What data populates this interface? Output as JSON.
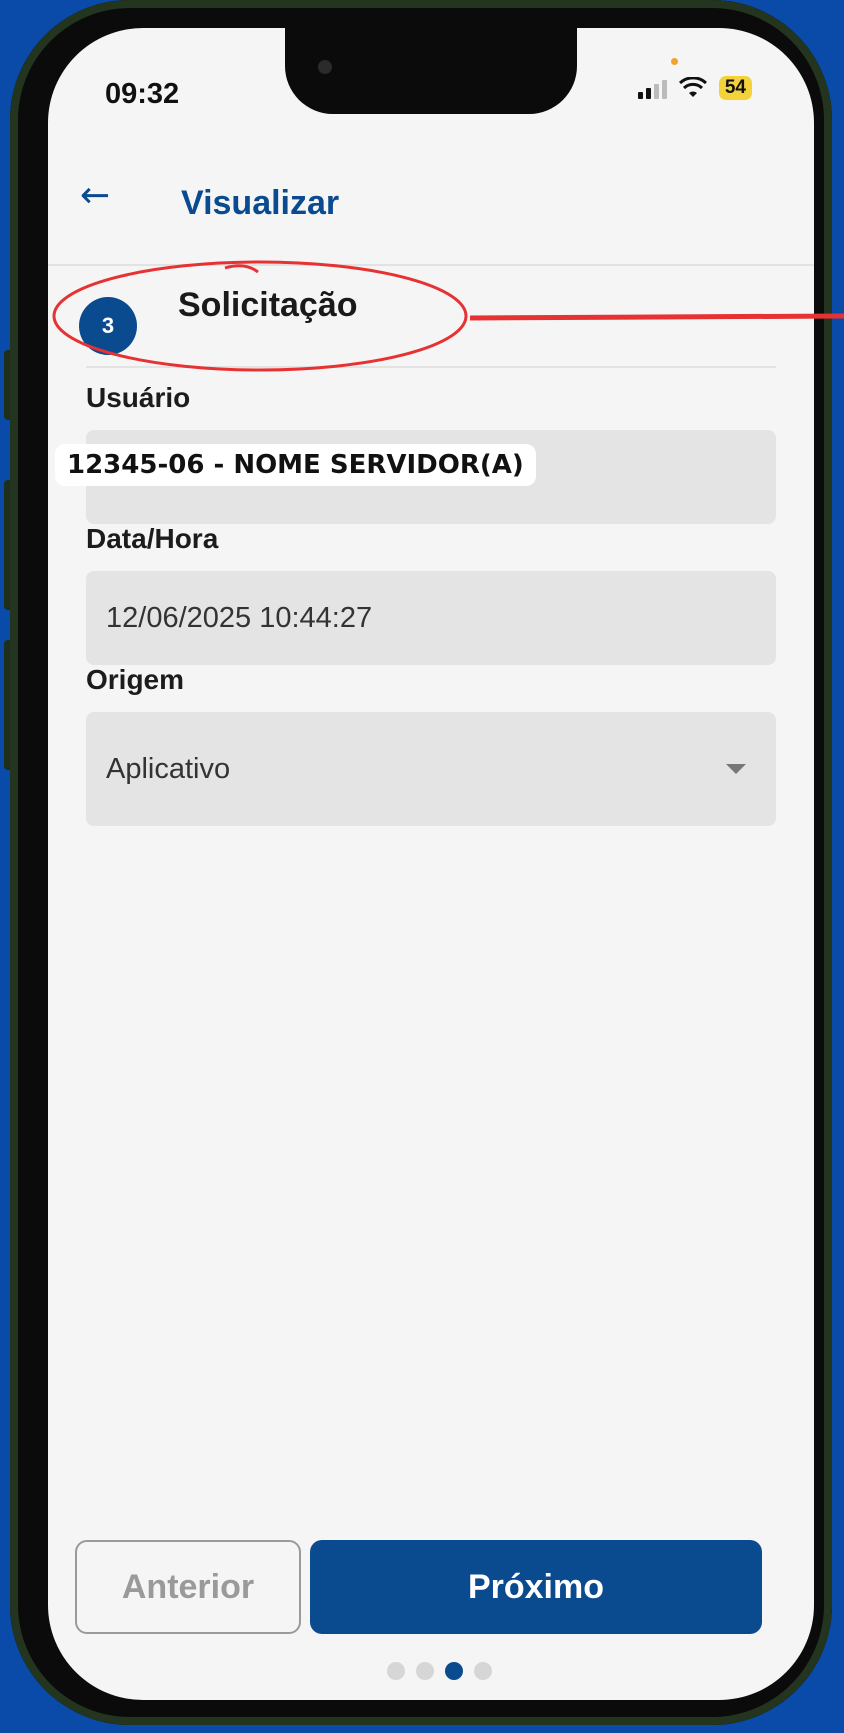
{
  "status": {
    "time": "09:32",
    "battery": "54"
  },
  "appbar": {
    "back_icon": "arrow-left-icon",
    "title": "Visualizar"
  },
  "step": {
    "number": "3",
    "title": "Solicitação"
  },
  "fields": {
    "usuario": {
      "label": "Usuário",
      "value": ""
    },
    "data_hora": {
      "label": "Data/Hora",
      "value": "12/06/2025 10:44:27"
    },
    "origem": {
      "label": "Origem",
      "value": "Aplicativo"
    }
  },
  "overlay": {
    "user_text": "12345-06 - NOME SERVIDOR(A)"
  },
  "buttons": {
    "previous": "Anterior",
    "next": "Próximo"
  },
  "pager": {
    "total": 4,
    "current": 3
  },
  "colors": {
    "primary": "#0a4a8e",
    "annotation": "#e63232",
    "background": "#0a4aa8"
  }
}
